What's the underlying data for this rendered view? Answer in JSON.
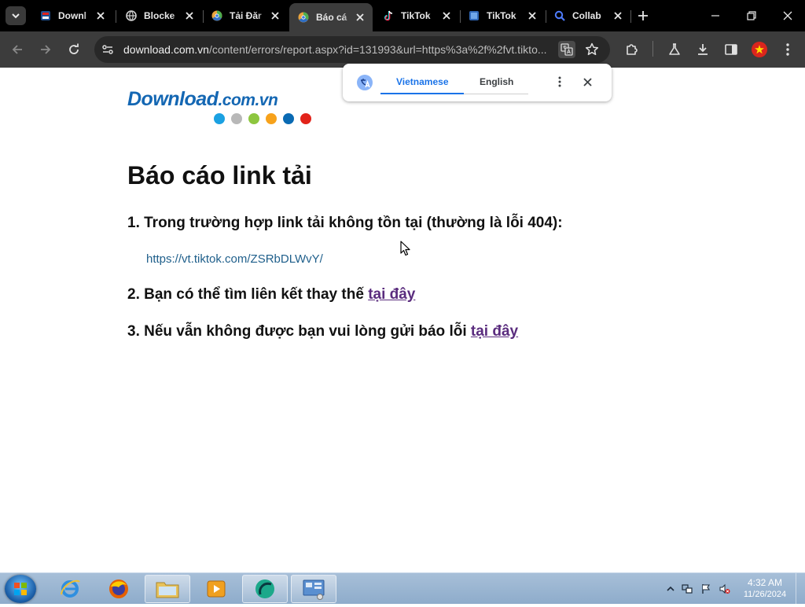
{
  "browser": {
    "tabs": [
      {
        "title": "Downl",
        "icon": "download-site-icon",
        "active": false
      },
      {
        "title": "Blocke",
        "icon": "globe-icon",
        "active": false
      },
      {
        "title": "Tải Đăr",
        "icon": "chrome-like-icon",
        "active": false
      },
      {
        "title": "Báo cá",
        "icon": "chrome-like-icon",
        "active": true
      },
      {
        "title": "TikTok",
        "icon": "tiktok-icon",
        "active": false
      },
      {
        "title": "TikTok",
        "icon": "tiktok-square-icon",
        "active": false
      },
      {
        "title": "Collab",
        "icon": "magnifier-icon",
        "active": false
      }
    ],
    "url_host": "download.com.vn",
    "url_path": "/content/errors/report.aspx?id=131993&url=https%3a%2f%2fvt.tikto...",
    "accent": "#1a73e8"
  },
  "translate": {
    "source_lang": "Vietnamese",
    "target_lang": "English"
  },
  "site": {
    "logo_main": "Download",
    "logo_domain": ".com.vn",
    "logo_dot_colors": [
      "#1ba1e2",
      "#b8b8b8",
      "#8dc63f",
      "#f7a21b",
      "#0a6ab3",
      "#e2231a"
    ]
  },
  "content": {
    "title": "Báo cáo link tải",
    "step1": "1. Trong trường hợp link tải không tồn tại (thường là lỗi 404):",
    "reported_url": "https://vt.tiktok.com/ZSRbDLWvY/",
    "step2_text": "2. Bạn có thể tìm liên kết thay thế ",
    "step2_link": "tại đây",
    "step3_text": "3. Nếu vẫn không được bạn vui lòng gửi báo lỗi ",
    "step3_link": "tại đây"
  },
  "taskbar": {
    "time": "4:32 AM",
    "date": "11/26/2024"
  }
}
